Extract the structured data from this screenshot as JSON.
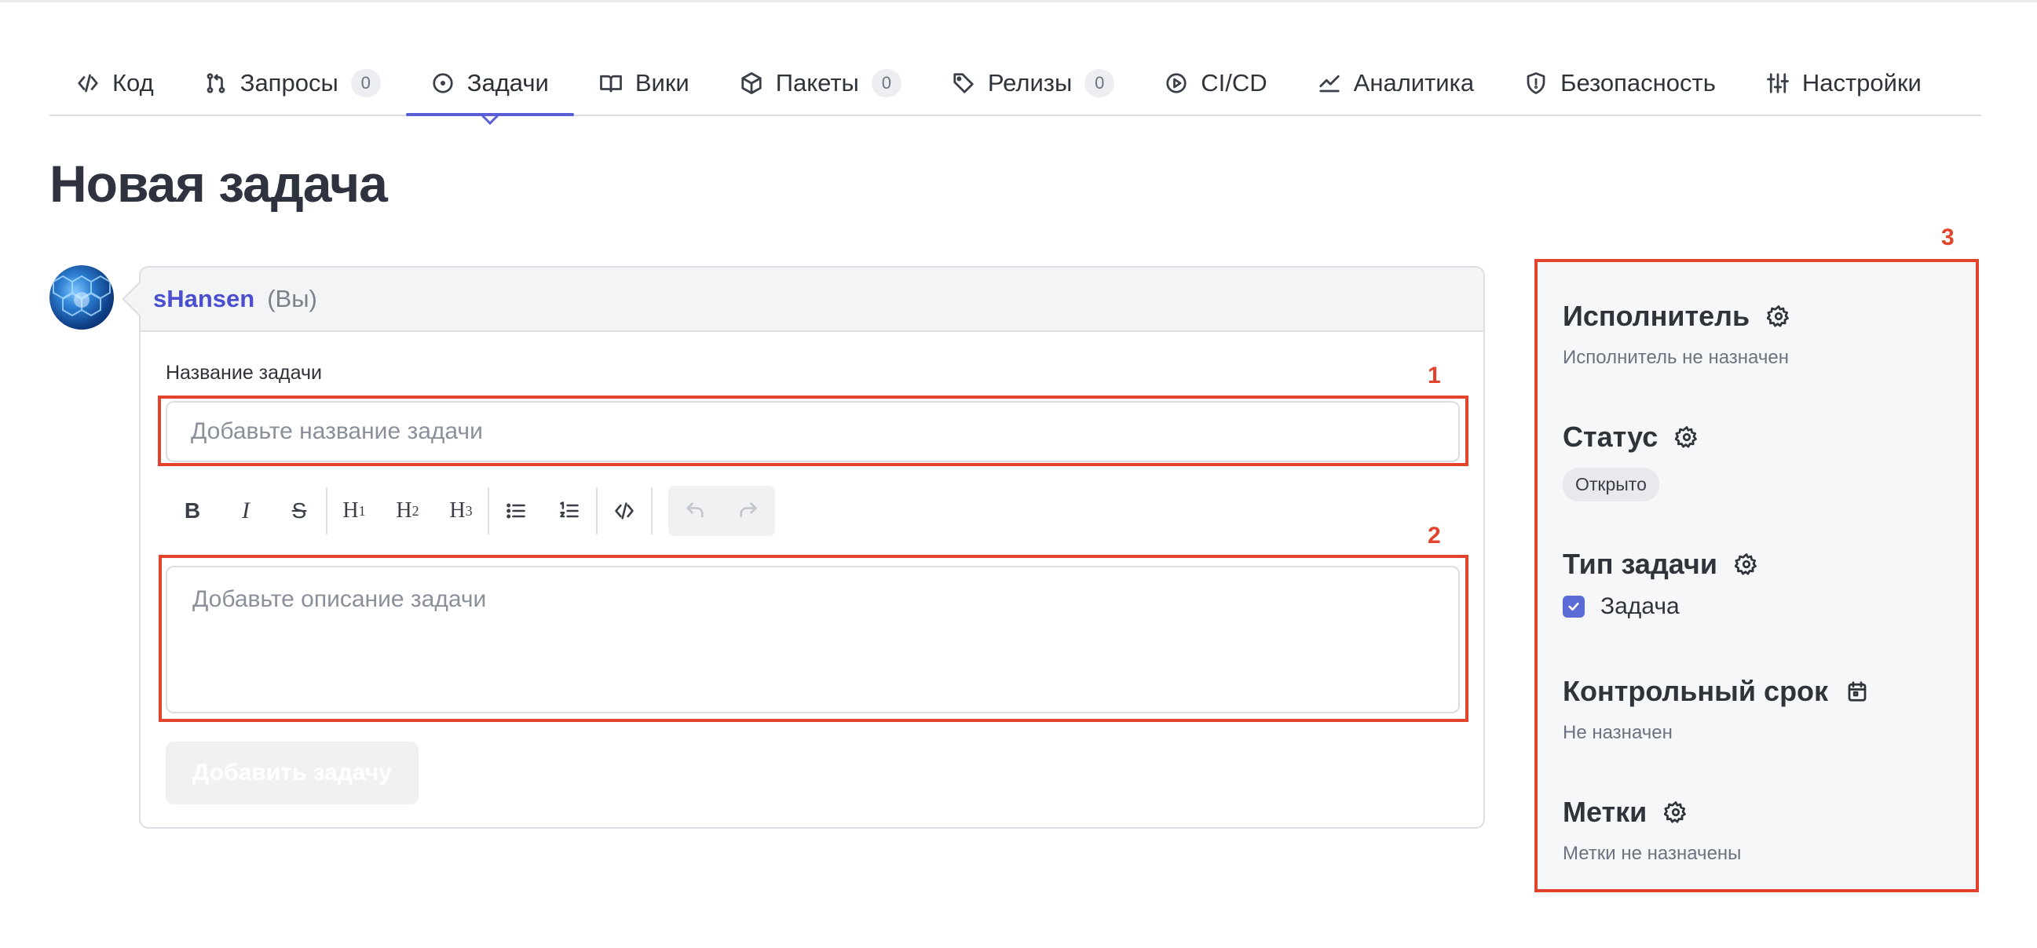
{
  "tabs": [
    {
      "label": "Код",
      "icon": "code-icon",
      "badge": null
    },
    {
      "label": "Запросы",
      "icon": "merge-request-icon",
      "badge": "0"
    },
    {
      "label": "Задачи",
      "icon": "issue-icon",
      "badge": null,
      "active": true
    },
    {
      "label": "Вики",
      "icon": "book-icon",
      "badge": null
    },
    {
      "label": "Пакеты",
      "icon": "package-icon",
      "badge": "0"
    },
    {
      "label": "Релизы",
      "icon": "tag-icon",
      "badge": "0"
    },
    {
      "label": "CI/CD",
      "icon": "play-circle-icon",
      "badge": null
    },
    {
      "label": "Аналитика",
      "icon": "chart-line-icon",
      "badge": null
    },
    {
      "label": "Безопасность",
      "icon": "shield-icon",
      "badge": null
    },
    {
      "label": "Настройки",
      "icon": "sliders-icon",
      "badge": null
    }
  ],
  "page_title": "Новая задача",
  "author": {
    "username": "sHansen",
    "suffix": "(Вы)"
  },
  "form": {
    "title_label": "Название задачи",
    "title_placeholder": "Добавьте название задачи",
    "description_placeholder": "Добавьте описание задачи",
    "submit_label": "Добавить задачу",
    "toolbar": {
      "bold": "B",
      "italic": "I",
      "strike": "S",
      "h1": "H",
      "h2": "H",
      "h3": "H",
      "h1_sub": "1",
      "h2_sub": "2",
      "h3_sub": "3"
    }
  },
  "annotations": {
    "one": "1",
    "two": "2",
    "three": "3"
  },
  "sidebar": {
    "assignee_title": "Исполнитель",
    "assignee_value": "Исполнитель не назначен",
    "status_title": "Статус",
    "status_value": "Открыто",
    "type_title": "Тип задачи",
    "type_value": "Задача",
    "due_title": "Контрольный срок",
    "due_value": "Не назначен",
    "labels_title": "Метки",
    "labels_value": "Метки не назначены"
  },
  "colors": {
    "accent": "#5b5fd6",
    "annotation": "#e2432c",
    "checkbox": "#5b6bd6"
  }
}
